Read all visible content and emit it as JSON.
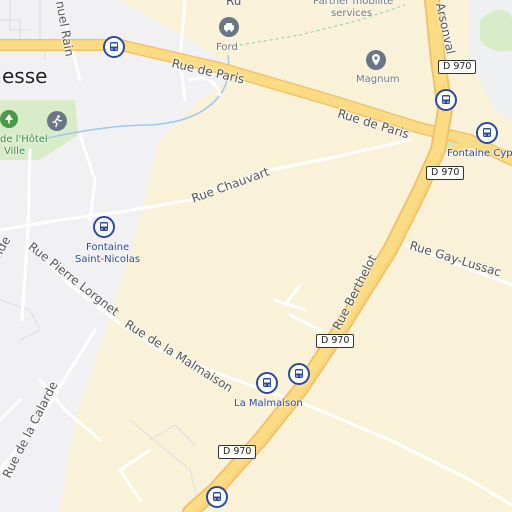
{
  "place": {
    "name": "esse"
  },
  "roads": {
    "rue_de_paris_1": "Rue de Paris",
    "rue_de_paris_2": "Rue de Paris",
    "rue_chauvart": "Rue Chauvart",
    "rue_gay_lussac": "Rue Gay-Lussac",
    "rue_berthelot": "Rue Berthelot",
    "rue_pierre_lorgnet": "Rue Pierre Lorgnet",
    "rue_malmaison": "Rue de la Malmaison",
    "rue_calarde": "Rue de la Calarde",
    "arsonval": "Arsonval",
    "nuel_rain": "nuel Rain",
    "nde": "nde",
    "top_fragment": "Ru"
  },
  "shields": [
    "D 970",
    "D 970",
    "D 970",
    "D 970"
  ],
  "pois": {
    "ford": "Ford",
    "magnum": "Magnum",
    "partner_line1": "Partner mobilité",
    "partner_line2": "services",
    "hotel_line1": "de l'Hôtel",
    "hotel_line2": "Ville"
  },
  "bus_stops": {
    "fontaine_saint_nicolas_line1": "Fontaine",
    "fontaine_saint_nicolas_line2": "Saint-Nicolas",
    "la_malmaison": "La Malmaison",
    "fontaine_cypierre": "Fontaine Cypie"
  },
  "colors": {
    "commercial_area": "#f9f1d8",
    "urban_area": "#f1f1f3",
    "major_road": "#fbdc85",
    "major_road_casing": "#f0c36b",
    "minor_road": "#ffffff",
    "water": "#9ec8ec",
    "park": "#d9ecc9",
    "transit_blue": "#2b4a9a",
    "poi_gray": "#6a7585"
  },
  "icons": {
    "bus": "bus-icon",
    "ford": "car-dealer-icon",
    "magnum": "map-pin-icon",
    "park": "tree-icon",
    "fitness": "running-person-icon"
  }
}
